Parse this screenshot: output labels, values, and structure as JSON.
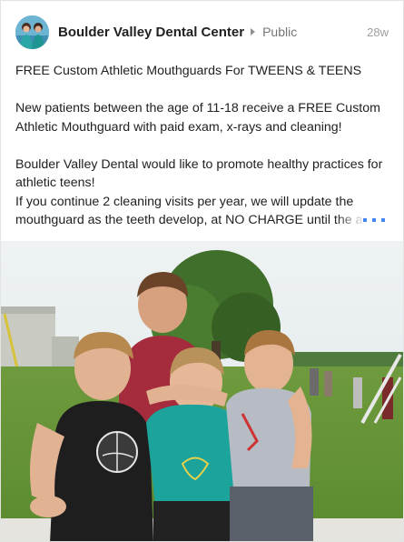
{
  "post": {
    "author": "Boulder Valley Dental Center",
    "visibility": "Public",
    "timestamp": "28w",
    "paragraphs": {
      "headline": "FREE Custom Athletic Mouthguards For TWEENS & TEENS",
      "offer": "New patients between the age of 11-18 receive a FREE Custom Athletic Mouthguard with paid exam, x-rays and cleaning!",
      "promote": "Boulder Valley Dental would like to promote healthy practices for athletic teens!",
      "continue_line": "If you continue 2 cleaning visits per year, we will update the mouthguard as the teeth develop, at NO CHARGE until the age"
    }
  },
  "icons": {
    "avatar": "avatar-photo",
    "caret": "caret-right-icon",
    "more": "more-dots-icon"
  },
  "colors": {
    "link_blue": "#4285f4",
    "meta_gray": "#757575",
    "text": "#212121"
  }
}
